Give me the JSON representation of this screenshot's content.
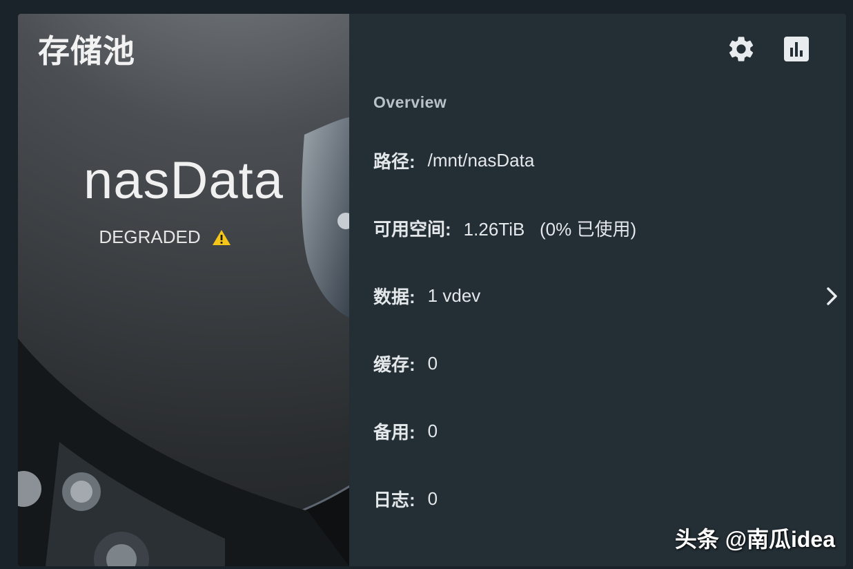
{
  "card": {
    "title": "存储池",
    "pool_name": "nasData",
    "status": "DEGRADED",
    "status_icon": "warning-icon",
    "status_color": "#f5c518"
  },
  "toolbar": {
    "settings_icon": "gear-icon",
    "stats_icon": "bar-chart-icon"
  },
  "overview": {
    "title": "Overview",
    "rows": [
      {
        "label": "路径:",
        "value": "/mnt/nasData"
      },
      {
        "label": "可用空间:",
        "value": "1.26TiB   (0% 已使用)"
      },
      {
        "label": "数据:",
        "value": "1 vdev"
      },
      {
        "label": "缓存:",
        "value": "0"
      },
      {
        "label": "备用:",
        "value": "0"
      },
      {
        "label": "日志:",
        "value": "0"
      }
    ]
  },
  "watermark": "头条 @南瓜idea"
}
